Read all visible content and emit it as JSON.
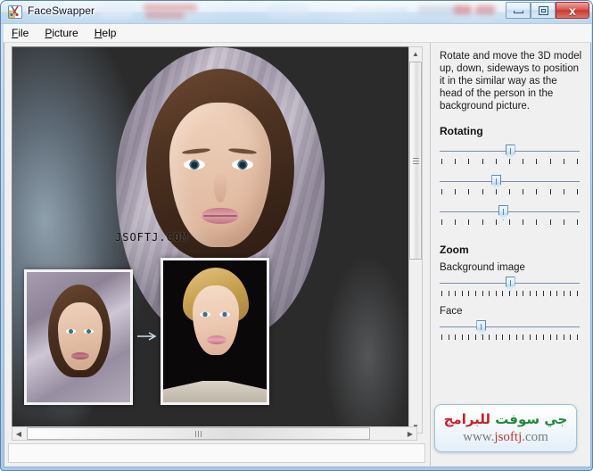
{
  "window": {
    "title": "FaceSwapper",
    "icon": "app-icon",
    "buttons": {
      "minimize": "–",
      "maximize": "□",
      "close": "x"
    }
  },
  "menubar": {
    "items": [
      {
        "accel": "F",
        "rest": "ile"
      },
      {
        "accel": "P",
        "rest": "icture"
      },
      {
        "accel": "H",
        "rest": "elp"
      }
    ]
  },
  "picture": {
    "watermark": "JSOFTJ.COM",
    "thumbnails": [
      {
        "name": "source-face-thumbnail"
      },
      {
        "name": "target-face-thumbnail"
      }
    ],
    "scroll": {
      "up": "▲",
      "down": "▼",
      "left": "◀",
      "right": "▶"
    }
  },
  "controls": {
    "instructions": "Rotate and move the 3D model up, down, sideways to position it in the similar way as the head of the person in the background picture.",
    "rotating": {
      "title": "Rotating",
      "sliders": [
        {
          "name": "rotate-x-slider",
          "value": 50,
          "ticks": 11
        },
        {
          "name": "rotate-y-slider",
          "value": 40,
          "ticks": 11
        },
        {
          "name": "rotate-z-slider",
          "value": 45,
          "ticks": 11
        }
      ]
    },
    "zoom": {
      "title": "Zoom",
      "sliders": [
        {
          "name": "background-image-zoom-slider",
          "label": "Background image",
          "value": 50,
          "ticks": 21
        },
        {
          "name": "face-zoom-slider",
          "label": "Face",
          "value": 29,
          "ticks": 21
        }
      ]
    }
  },
  "badge": {
    "arabic_green": "جي سوفت",
    "arabic_red": "للبرامج",
    "url_prefix": "www.",
    "url_main": "jsoftj",
    "url_suffix": ".com"
  },
  "colors": {
    "accent": "#5b8ab5",
    "panel": "#f0f0f0",
    "close_button": "#c33c33",
    "badge_green": "#1f8a3a",
    "badge_red": "#cc1f26"
  }
}
